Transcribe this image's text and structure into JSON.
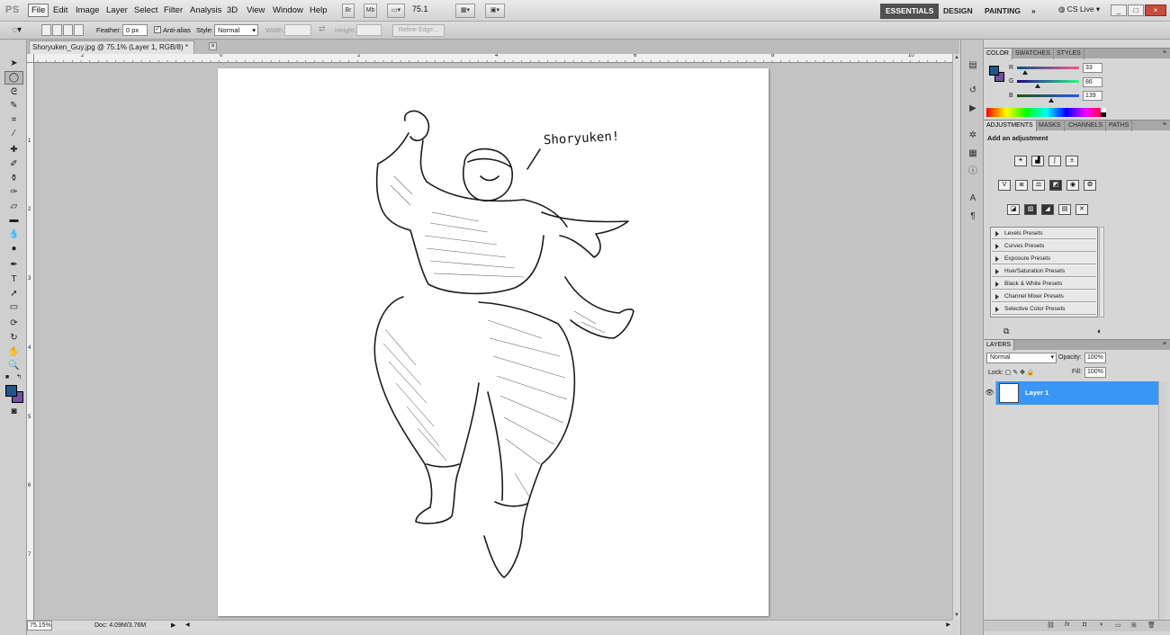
{
  "app": {
    "logo": "PS"
  },
  "menubar": {
    "items": [
      "File",
      "Edit",
      "Image",
      "Layer",
      "Select",
      "Filter",
      "Analysis",
      "3D",
      "View",
      "Window",
      "Help"
    ],
    "bridge": "Br",
    "minibridge": "Mb",
    "zoom": "75.1",
    "workspaces": [
      "ESSENTIALS",
      "DESIGN",
      "PAINTING"
    ],
    "more_workspaces": "»",
    "cs_live": "CS Live",
    "win_min": "_",
    "win_max": "□",
    "win_close": "×"
  },
  "options": {
    "feather_label": "Feather:",
    "feather_value": "0 px",
    "antialias_label": "Anti-alias",
    "antialias_checked": "✓",
    "style_label": "Style:",
    "style_value": "Normal",
    "width_label": "Width:",
    "height_label": "Height:",
    "refine_edge": "Refine Edge..."
  },
  "document": {
    "tab_title": "Shoryuken_Guy.jpg @ 75.1% (Layer 1, RGB/8) *",
    "tab_close": "×",
    "caption": "Shoryuken!",
    "ruler_top": [
      "2",
      "0",
      "2",
      "4",
      "6",
      "8",
      "10"
    ],
    "ruler_left": [
      "1",
      "2",
      "3",
      "4",
      "5",
      "6",
      "7"
    ]
  },
  "status": {
    "zoom": "75.15%",
    "doc": "Doc: 4.09M/3.76M"
  },
  "color_panel": {
    "tabs": [
      "COLOR",
      "SWATCHES",
      "STYLES"
    ],
    "r_label": "R",
    "g_label": "G",
    "b_label": "B",
    "r": 33,
    "g": 86,
    "b": 139,
    "fg_color": "#21568b",
    "bg_color": "#6f4f9e"
  },
  "adjustments_panel": {
    "tabs": [
      "ADJUSTMENTS",
      "MASKS",
      "CHANNELS",
      "PATHS"
    ],
    "heading": "Add an adjustment",
    "presets": [
      "Levels Presets",
      "Curves Presets",
      "Exposure Presets",
      "Hue/Saturation Presets",
      "Black & White Presets",
      "Channel Mixer Presets",
      "Selective Color Presets"
    ]
  },
  "layers_panel": {
    "tab": "LAYERS",
    "blend_mode": "Normal",
    "opacity_label": "Opacity:",
    "opacity": "100%",
    "lock_label": "Lock:",
    "fill_label": "Fill:",
    "fill": "100%",
    "layer_name": "Layer 1",
    "footer_fx": "fx"
  },
  "colors": {
    "accent": "#3a96f4",
    "workspace_active": "#505050"
  }
}
